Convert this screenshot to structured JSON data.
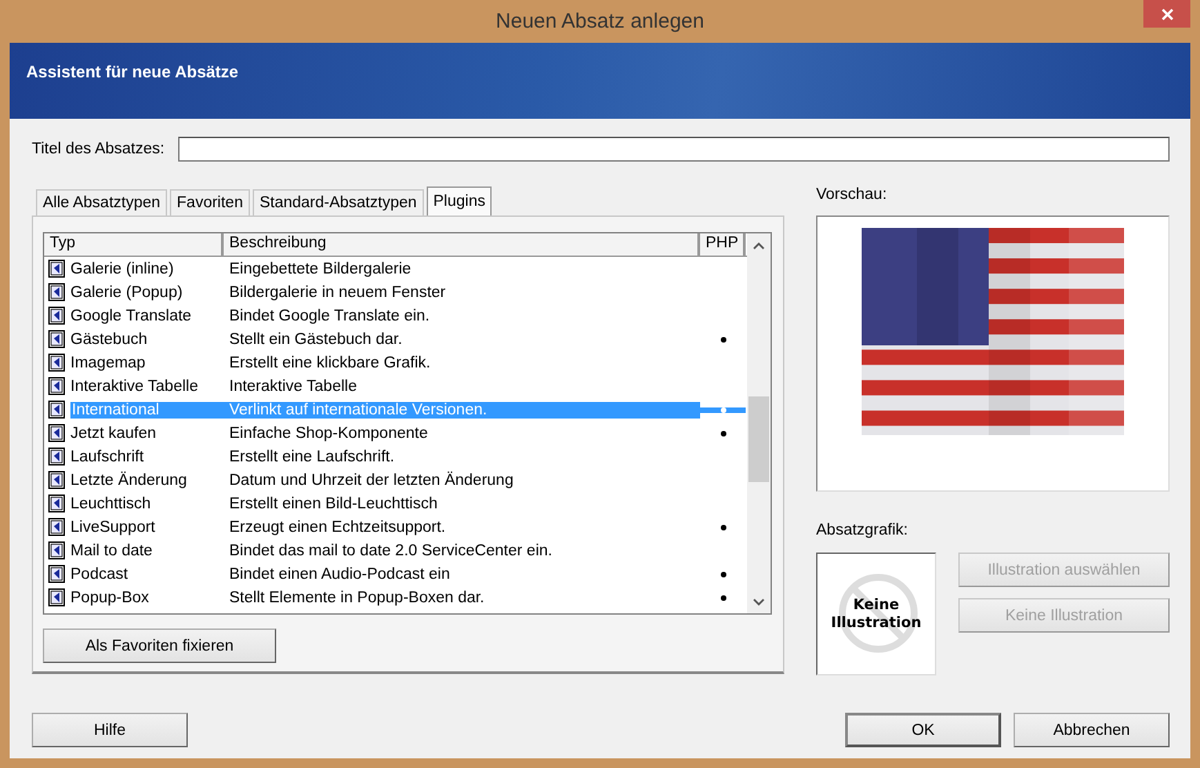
{
  "window": {
    "title": "Neuen Absatz anlegen"
  },
  "header": {
    "title": "Assistent für neue Absätze"
  },
  "title_field": {
    "label": "Titel des Absatzes:"
  },
  "tabs": [
    {
      "label": "Alle Absatztypen",
      "selected": false
    },
    {
      "label": "Favoriten",
      "selected": false
    },
    {
      "label": "Standard-Absatztypen",
      "selected": false
    },
    {
      "label": "Plugins",
      "selected": true
    }
  ],
  "table": {
    "columns": [
      "Typ",
      "Beschreibung",
      "PHP"
    ],
    "rows": [
      {
        "type": "Galerie (inline)",
        "description": "Eingebettete Bildergalerie",
        "php": false,
        "selected": false
      },
      {
        "type": "Galerie (Popup)",
        "description": "Bildergalerie in neuem Fenster",
        "php": false,
        "selected": false
      },
      {
        "type": "Google Translate",
        "description": "Bindet Google Translate ein.",
        "php": false,
        "selected": false
      },
      {
        "type": "Gästebuch",
        "description": "Stellt ein Gästebuch dar.",
        "php": true,
        "selected": false
      },
      {
        "type": "Imagemap",
        "description": "Erstellt eine klickbare Grafik.",
        "php": false,
        "selected": false
      },
      {
        "type": "Interaktive Tabelle",
        "description": "Interaktive Tabelle",
        "php": false,
        "selected": false
      },
      {
        "type": "International",
        "description": "Verlinkt auf internationale Versionen.",
        "php": true,
        "selected": true
      },
      {
        "type": "Jetzt kaufen",
        "description": "Einfache Shop-Komponente",
        "php": true,
        "selected": false
      },
      {
        "type": "Laufschrift",
        "description": "Erstellt eine Laufschrift.",
        "php": false,
        "selected": false
      },
      {
        "type": "Letzte Änderung",
        "description": "Datum und Uhrzeit der letzten Änderung",
        "php": false,
        "selected": false
      },
      {
        "type": "Leuchttisch",
        "description": "Erstellt einen Bild-Leuchttisch",
        "php": false,
        "selected": false
      },
      {
        "type": "LiveSupport",
        "description": "Erzeugt einen Echtzeitsupport.",
        "php": true,
        "selected": false
      },
      {
        "type": "Mail to date",
        "description": "Bindet das mail to date 2.0 ServiceCenter ein.",
        "php": false,
        "selected": false
      },
      {
        "type": "Podcast",
        "description": "Bindet einen Audio-Podcast ein",
        "php": true,
        "selected": false
      },
      {
        "type": "Popup-Box",
        "description": "Stellt Elemente in Popup-Boxen dar.",
        "php": true,
        "selected": false
      }
    ]
  },
  "favorite_button": {
    "label": "Als Favoriten fixieren"
  },
  "preview": {
    "label": "Vorschau:",
    "kind": "picture"
  },
  "graphic": {
    "label": "Absatzgrafik:",
    "placeholder_text": "Keine Illustration",
    "buttons": [
      {
        "label": "Illustration auswählen",
        "disabled": true
      },
      {
        "label": "Keine Illustration",
        "disabled": true
      }
    ]
  },
  "buttons": [
    {
      "label": "Hilfe",
      "default": false
    },
    {
      "label": "OK",
      "default": true
    },
    {
      "label": "Abbrechen",
      "default": false
    }
  ]
}
